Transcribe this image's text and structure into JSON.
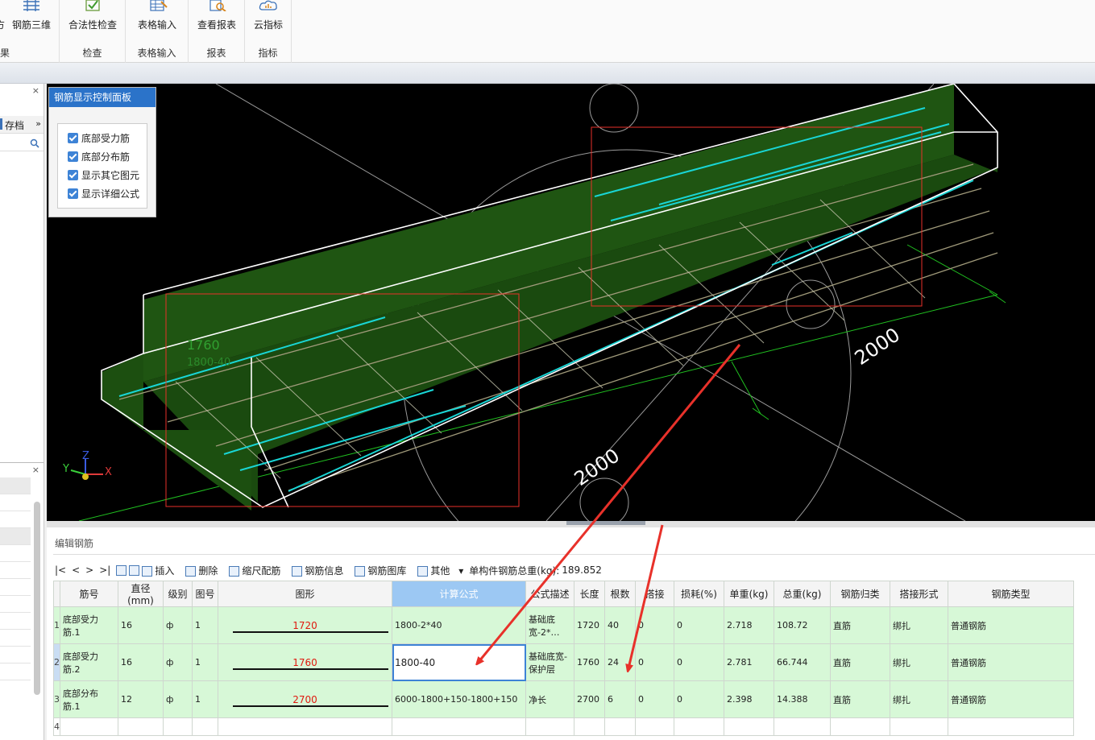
{
  "ribbon": {
    "groups": [
      {
        "name": "result",
        "label": "果",
        "buttons": [
          {
            "label": "钢筋三维",
            "icon": "rebar-3d-icon"
          },
          {
            "label": "方",
            "icon": ""
          }
        ]
      },
      {
        "name": "check",
        "label": "检查",
        "buttons": [
          {
            "label": "合法性检查",
            "icon": "check-icon"
          }
        ]
      },
      {
        "name": "table-input",
        "label": "表格输入",
        "buttons": [
          {
            "label": "表格输入",
            "icon": "table-input-icon"
          }
        ]
      },
      {
        "name": "report",
        "label": "报表",
        "buttons": [
          {
            "label": "查看报表",
            "icon": "report-search-icon"
          }
        ]
      },
      {
        "name": "index",
        "label": "指标",
        "buttons": [
          {
            "label": "云指标",
            "icon": "cloud-icon"
          }
        ]
      }
    ]
  },
  "left_panel": {
    "archive_label": "存档",
    "close_glyph": "×",
    "more_glyph": "»"
  },
  "control_panel": {
    "title": "钢筋显示控制面板",
    "options": [
      {
        "label": "底部受力筋",
        "checked": true
      },
      {
        "label": "底部分布筋",
        "checked": true
      },
      {
        "label": "显示其它图元",
        "checked": true
      },
      {
        "label": "显示详细公式",
        "checked": true
      }
    ]
  },
  "viewport": {
    "dim_labels": [
      "2000",
      "2000"
    ],
    "rebar_label_1": "1760",
    "rebar_label_2": "1800-40",
    "axis": {
      "x": "X",
      "y": "Y",
      "z": "Z"
    }
  },
  "edit_panel": {
    "title": "编辑钢筋",
    "toolbar": {
      "nav": [
        "|<",
        "<",
        ">",
        ">|"
      ],
      "insert": "插入",
      "delete": "删除",
      "scale": "缩尺配筋",
      "info": "钢筋信息",
      "library": "钢筋图库",
      "other": "其他",
      "total_label": "单构件钢筋总重(kg):",
      "total_value": "189.852"
    },
    "columns": [
      "筋号",
      "直径(mm)",
      "级别",
      "图号",
      "图形",
      "计算公式",
      "公式描述",
      "长度",
      "根数",
      "搭接",
      "损耗(%)",
      "单重(kg)",
      "总重(kg)",
      "钢筋归类",
      "搭接形式",
      "钢筋类型"
    ],
    "rows": [
      {
        "row": "1",
        "name": "底部受力筋.1",
        "diameter": "16",
        "grade": "ф",
        "fig": "1",
        "shape": "1720",
        "formula": "1800-2*40",
        "desc": "基础底宽-2*…",
        "length": "1720",
        "count": "40",
        "lap": "0",
        "loss": "0",
        "unit_weight": "2.718",
        "total_weight": "108.72",
        "category": "直筋",
        "lap_type": "绑扎",
        "type": "普通钢筋"
      },
      {
        "row": "2",
        "name": "底部受力筋.2",
        "diameter": "16",
        "grade": "ф",
        "fig": "1",
        "shape": "1760",
        "formula": "1800-40",
        "desc": "基础底宽-保护层",
        "length": "1760",
        "count": "24",
        "lap": "0",
        "loss": "0",
        "unit_weight": "2.781",
        "total_weight": "66.744",
        "category": "直筋",
        "lap_type": "绑扎",
        "type": "普通钢筋"
      },
      {
        "row": "3",
        "name": "底部分布筋.1",
        "diameter": "12",
        "grade": "ф",
        "fig": "1",
        "shape": "2700",
        "formula": "6000-1800+150-1800+150",
        "desc": "净长",
        "length": "2700",
        "count": "6",
        "lap": "0",
        "loss": "0",
        "unit_weight": "2.398",
        "total_weight": "14.388",
        "category": "直筋",
        "lap_type": "绑扎",
        "type": "普通钢筋"
      }
    ],
    "empty_row_number": "4"
  },
  "colors": {
    "accent": "#2b73c9",
    "row_green": "#d7f8d7",
    "shape_red": "#e0190f",
    "annotation_red": "#e8312a",
    "rebar_cyan": "#19d6d6",
    "concrete_green": "#1f5512"
  }
}
